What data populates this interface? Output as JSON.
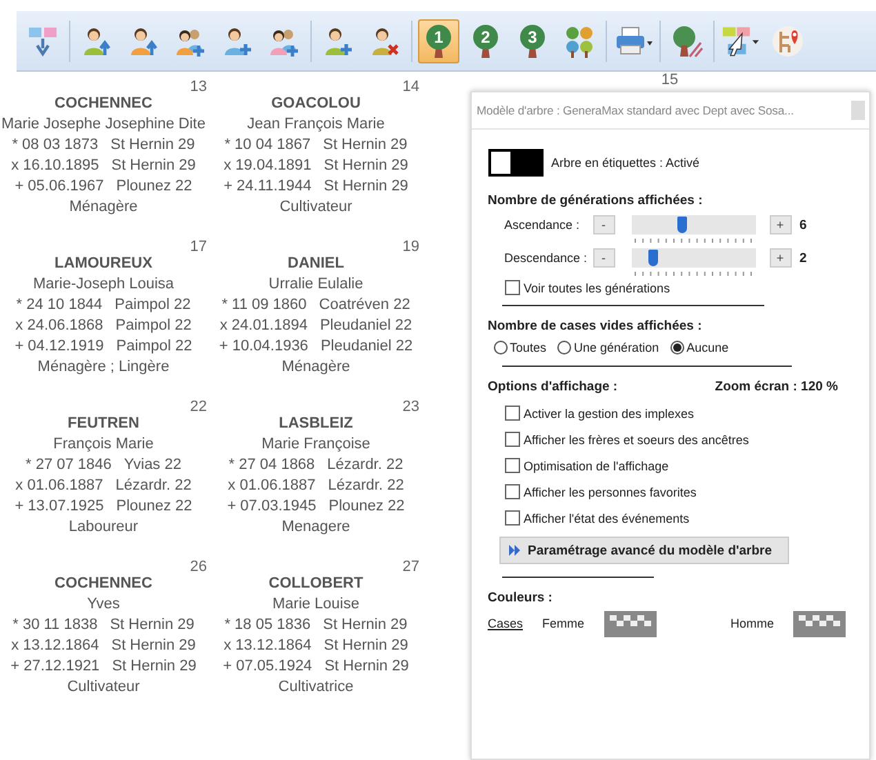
{
  "toolbar": [
    {
      "kind": "diagram",
      "selected": false
    },
    {
      "kind": "separator"
    },
    {
      "kind": "person-up",
      "color": "#9bbf3a",
      "selected": false
    },
    {
      "kind": "person-up",
      "color": "#f0a040",
      "selected": false
    },
    {
      "kind": "couple-add",
      "color": "#f0a040",
      "selected": false
    },
    {
      "kind": "person-add",
      "color": "#6ab0e0",
      "selected": false
    },
    {
      "kind": "couple-add",
      "color": "#f0a0b8",
      "selected": false
    },
    {
      "kind": "separator"
    },
    {
      "kind": "person-add",
      "color": "#9bbf3a",
      "selected": false
    },
    {
      "kind": "person-remove",
      "color": "#c8b040",
      "selected": false
    },
    {
      "kind": "separator"
    },
    {
      "kind": "tree-number",
      "label": "1",
      "selected": true
    },
    {
      "kind": "tree-number",
      "label": "2",
      "selected": false
    },
    {
      "kind": "tree-number",
      "label": "3",
      "selected": false
    },
    {
      "kind": "trees",
      "selected": false
    },
    {
      "kind": "separator"
    },
    {
      "kind": "printer",
      "selected": false
    },
    {
      "kind": "separator"
    },
    {
      "kind": "tree-edit",
      "selected": false
    },
    {
      "kind": "separator"
    },
    {
      "kind": "pointer",
      "selected": false
    },
    {
      "kind": "map-pin",
      "selected": false
    }
  ],
  "persons": [
    {
      "number": "13",
      "surname": "COCHENNEC",
      "given": "Marie Josephe Josephine Dite",
      "events": [
        {
          "date": "* 08 03 1873",
          "place": "St Hernin 29"
        },
        {
          "date": "x 16.10.1895",
          "place": "St Hernin 29"
        },
        {
          "date": "+ 05.06.1967",
          "place": "Plounez 22"
        }
      ],
      "occupation": "Ménagère"
    },
    {
      "number": "14",
      "surname": "GOACOLOU",
      "given": "Jean François Marie",
      "events": [
        {
          "date": "* 10 04 1867",
          "place": "St Hernin 29"
        },
        {
          "date": "x 19.04.1891",
          "place": "St Hernin 29"
        },
        {
          "date": "+ 24.11.1944",
          "place": "St Hernin 29"
        }
      ],
      "occupation": "Cultivateur"
    },
    {
      "number": "17",
      "surname": "LAMOUREUX",
      "given": "Marie-Joseph Louisa",
      "events": [
        {
          "date": "* 24 10 1844",
          "place": "Paimpol 22"
        },
        {
          "date": "x 24.06.1868",
          "place": "Paimpol 22"
        },
        {
          "date": "+ 04.12.1919",
          "place": "Paimpol 22"
        }
      ],
      "occupation": "Ménagère ; Lingère"
    },
    {
      "number": "19",
      "surname": "DANIEL",
      "given": "Urralie Eulalie",
      "events": [
        {
          "date": "* 11 09 1860",
          "place": "Coatréven 22"
        },
        {
          "date": "x 24.01.1894",
          "place": "Pleudaniel 22"
        },
        {
          "date": "+ 10.04.1936",
          "place": "Pleudaniel 22"
        }
      ],
      "occupation": "Ménagère"
    },
    {
      "number": "22",
      "surname": "FEUTREN",
      "given": "François Marie",
      "events": [
        {
          "date": "* 27 07 1846",
          "place": "Yvias 22"
        },
        {
          "date": "x 01.06.1887",
          "place": "Lézardr. 22"
        },
        {
          "date": "+ 13.07.1925",
          "place": "Plounez 22"
        }
      ],
      "occupation": "Laboureur"
    },
    {
      "number": "23",
      "surname": "LASBLEIZ",
      "given": "Marie Françoise",
      "events": [
        {
          "date": "* 27 04 1868",
          "place": "Lézardr. 22"
        },
        {
          "date": "x 01.06.1887",
          "place": "Lézardr. 22"
        },
        {
          "date": "+ 07.03.1945",
          "place": "Plounez 22"
        }
      ],
      "occupation": "Menagere"
    },
    {
      "number": "26",
      "surname": "COCHENNEC",
      "given": "Yves",
      "events": [
        {
          "date": "* 30 11 1838",
          "place": "St Hernin 29"
        },
        {
          "date": "x 13.12.1864",
          "place": "St Hernin 29"
        },
        {
          "date": "+ 27.12.1921",
          "place": "St Hernin 29"
        }
      ],
      "occupation": "Cultivateur"
    },
    {
      "number": "27",
      "surname": "COLLOBERT",
      "given": "Marie Louise",
      "events": [
        {
          "date": "* 18 05 1836",
          "place": "St Hernin 29"
        },
        {
          "date": "x 13.12.1864",
          "place": "St Hernin 29"
        },
        {
          "date": "+ 07.05.1924",
          "place": "St Hernin 29"
        }
      ],
      "occupation": "Cultivatrice"
    }
  ],
  "hidden_number": "15",
  "panel": {
    "title": "Modèle d'arbre : GeneraMax standard avec Dept avec Sosa...",
    "switch": {
      "on": true,
      "label": "Arbre en étiquettes : Activé"
    },
    "generations": {
      "heading": "Nombre de générations affichées :",
      "sliders": [
        {
          "label": "Ascendance :",
          "minus": "-",
          "plus": "+",
          "level": 0.4,
          "value": "6"
        },
        {
          "label": "Descendance :",
          "minus": "-",
          "plus": "+",
          "level": 0.15,
          "value": "2"
        }
      ],
      "show_all": {
        "label": "Voir toutes les générations",
        "checked": false
      }
    },
    "empty_boxes": {
      "heading": "Nombre de cases vides affichées :",
      "options": [
        {
          "label": "Toutes",
          "selected": false
        },
        {
          "label": "Une génération",
          "selected": false
        },
        {
          "label": "Aucune",
          "selected": true
        }
      ]
    },
    "display": {
      "heading": "Options d'affichage :",
      "zoom": "Zoom écran : 120 %",
      "options": [
        {
          "label": "Activer la gestion des implexes",
          "checked": false
        },
        {
          "label": "Afficher les frères et soeurs des ancêtres",
          "checked": false
        },
        {
          "label": "Optimisation de l'affichage",
          "checked": false
        },
        {
          "label": "Afficher les personnes favorites",
          "checked": false
        },
        {
          "label": "Afficher l'état des événements",
          "checked": false
        }
      ],
      "advanced": "Paramétrage avancé du modèle d'arbre"
    },
    "colors": {
      "heading": "Couleurs :",
      "link": "Cases",
      "female": "Femme",
      "male": "Homme"
    }
  }
}
